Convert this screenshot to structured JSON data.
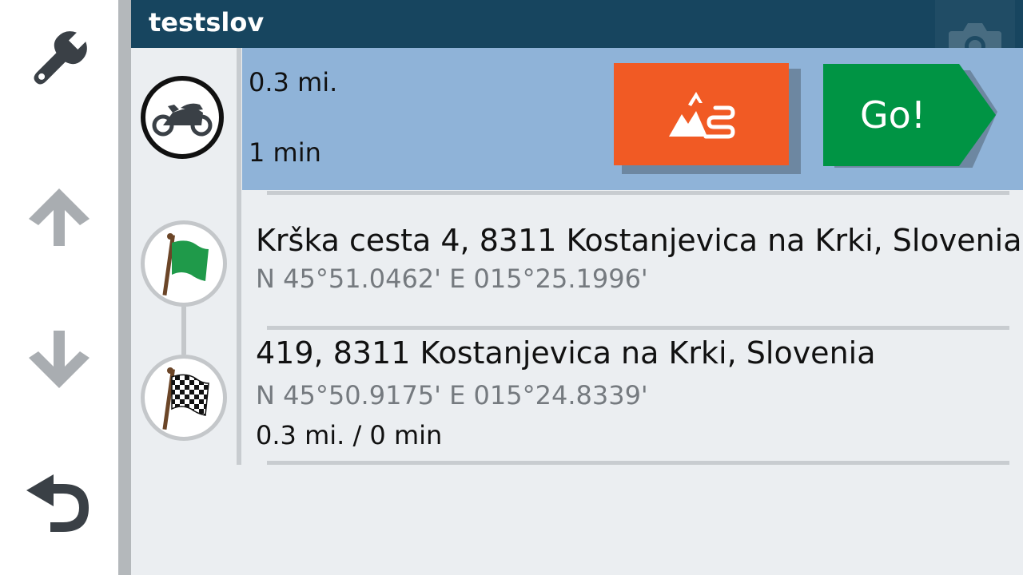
{
  "header": {
    "title": "testslov"
  },
  "sidebar": {
    "items": [
      {
        "name": "settings",
        "icon": "wrench-icon"
      },
      {
        "name": "move-up",
        "icon": "arrow-up-icon"
      },
      {
        "name": "move-down",
        "icon": "arrow-down-icon"
      },
      {
        "name": "back",
        "icon": "back-arrow-icon"
      }
    ]
  },
  "summary": {
    "distance": "0.3 mi.",
    "time": "1 min",
    "vehicle_icon": "motorcycle-icon",
    "scenic_icon": "scenic-route-icon",
    "go_label": "Go!"
  },
  "stops": [
    {
      "icon": "green-flag-icon",
      "address": "Krška cesta 4, 8311 Kostanjevica na Krki, Slovenia",
      "coords": "N 45°51.0462' E 015°25.1996'"
    },
    {
      "icon": "checkered-flag-icon",
      "address": "419, 8311 Kostanjevica na Krki, Slovenia",
      "coords": "N 45°50.9175' E 015°24.8339'",
      "leg": "0.3 mi. / 0 min"
    }
  ],
  "colors": {
    "header": "#17455f",
    "summary_bg": "#8fb3d8",
    "scenic": "#f15a24",
    "go": "#009444",
    "content_bg": "#ebeef1"
  }
}
